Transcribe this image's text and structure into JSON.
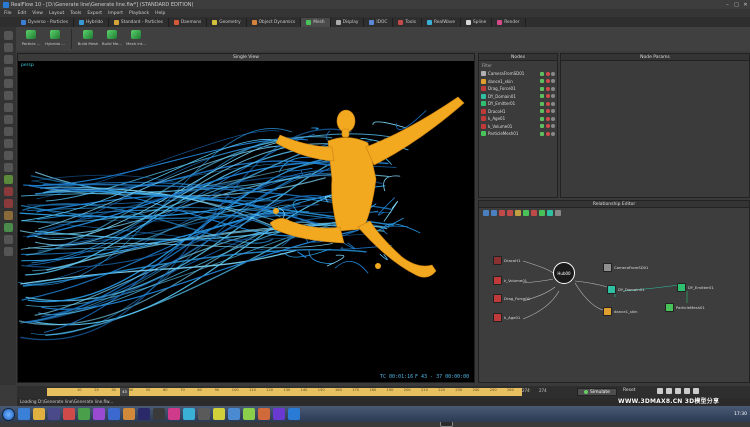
{
  "window": {
    "title": "RealFlow 10 - [D:\\Generate line\\Generate line.flw*] (STANDARD EDITION)"
  },
  "menu": [
    "File",
    "Edit",
    "View",
    "Layout",
    "Tools",
    "Export",
    "Import",
    "Playback",
    "Help"
  ],
  "shelf_tabs": [
    {
      "label": "Dyverso - Particles",
      "color": "#3a7fd6"
    },
    {
      "label": "Hybrido",
      "color": "#3a9ad6"
    },
    {
      "label": "Standard - Particles",
      "color": "#d6a23a"
    },
    {
      "label": "Daemons",
      "color": "#d65a3a"
    },
    {
      "label": "Geometry",
      "color": "#d6c23a"
    },
    {
      "label": "Object Dynamics",
      "color": "#d6823a"
    },
    {
      "label": "Mesh",
      "color": "#4ac25a"
    },
    {
      "label": "Display",
      "color": "#aaaaaa"
    },
    {
      "label": "IDOC",
      "color": "#5a8ad6"
    },
    {
      "label": "Tools",
      "color": "#c24a4a"
    },
    {
      "label": "RealWave",
      "color": "#3ab0d6"
    },
    {
      "label": "Spline",
      "color": "#d6d6d6"
    },
    {
      "label": "Render",
      "color": "#d64a8a"
    }
  ],
  "shelf_buttons": [
    "Particle ...",
    "Hybrido ...",
    "Build Mesh",
    "Build Me...",
    "Mesh int..."
  ],
  "viewport": {
    "title": "Single View",
    "camera": "persp",
    "timecode": "TC 00:01:16",
    "frames": "F 43 - 37 00:00:00"
  },
  "nodes": {
    "title": "Nodes",
    "filter": "Filter",
    "items": [
      {
        "name": "CameraFromSD01",
        "color": "#b0b0b0"
      },
      {
        "name": "dance1_skin",
        "color": "#e0a030"
      },
      {
        "name": "Drag_Force01",
        "color": "#c03a3a"
      },
      {
        "name": "DY_Domain01",
        "color": "#2ec0a0"
      },
      {
        "name": "DY_Emitter01",
        "color": "#2ec070"
      },
      {
        "name": "DracoH1",
        "color": "#c03a3a"
      },
      {
        "name": "k_Age01",
        "color": "#c03a3a"
      },
      {
        "name": "k_Volume01",
        "color": "#c03a3a"
      },
      {
        "name": "ParticleMesh01",
        "color": "#4ac25a"
      }
    ]
  },
  "node_params": {
    "title": "Node Params"
  },
  "relationship": {
    "title": "Relationship Editor",
    "hub": "Hub00",
    "nodes": [
      {
        "name": "DracoH1",
        "color": "#8a3030"
      },
      {
        "name": "k_Volume01",
        "color": "#c03a3a"
      },
      {
        "name": "Drag_Force01",
        "color": "#c03a3a"
      },
      {
        "name": "k_Age01",
        "color": "#c03a3a"
      },
      {
        "name": "CameraFromSD01",
        "color": "#909090"
      },
      {
        "name": "DY_Domain01",
        "color": "#2ec0a0"
      },
      {
        "name": "dance1_skin",
        "color": "#e0a030"
      },
      {
        "name": "DY_Emitter01",
        "color": "#2ec070"
      },
      {
        "name": "ParticleMesh01",
        "color": "#4ac25a"
      }
    ]
  },
  "timeline": {
    "ticks": [
      "10",
      "20",
      "30",
      "40",
      "50",
      "60",
      "70",
      "80",
      "90",
      "100",
      "110",
      "120",
      "130",
      "140",
      "150",
      "160",
      "170",
      "180",
      "190",
      "200",
      "210",
      "220",
      "230",
      "240",
      "250",
      "260",
      "270"
    ],
    "current_frame": "43",
    "end_a": "274",
    "end_b": "274",
    "simulate": "Simulate",
    "reset": "Reset"
  },
  "status": {
    "text": "Loading D:\\Generate line\\Generate line.flw..."
  },
  "taskbar": {
    "clock": "17:30"
  },
  "watermark": "WWW.3DMAX8.CN 3D模型分享"
}
